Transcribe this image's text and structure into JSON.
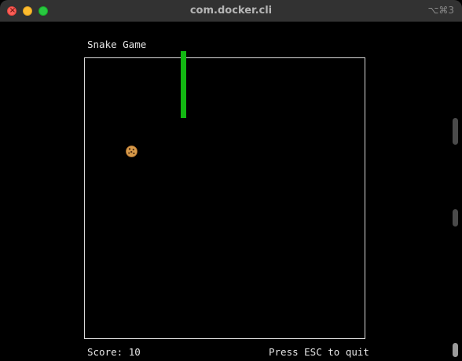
{
  "window": {
    "title": "com.docker.cli",
    "shortcut": "⌥⌘3",
    "close_glyph": "×"
  },
  "game": {
    "title": "Snake Game",
    "score_label": "Score:",
    "score": "10",
    "quit_hint": "Press ESC to quit",
    "snake_color": "#12b712",
    "board_border_color": "#d9d9d9",
    "food_icon": "cookie-icon"
  },
  "colors": {
    "terminal_background": "#000000",
    "titlebar": "#323232",
    "close": "#ff5f57",
    "minimize": "#febc2e",
    "maximize": "#28c840"
  }
}
